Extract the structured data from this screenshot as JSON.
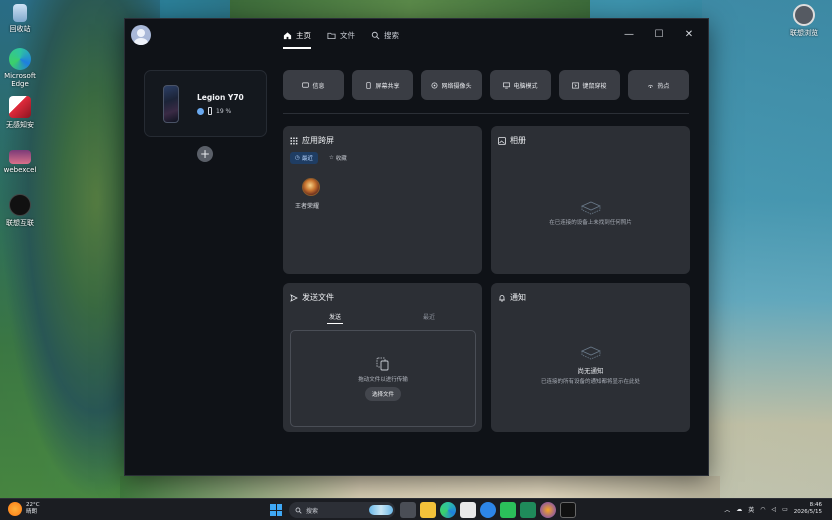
{
  "desktop": {
    "icons_left": [
      {
        "label": "回收站"
      },
      {
        "label": "Microsoft Edge"
      },
      {
        "label": "无感知安"
      },
      {
        "label": "webexcel"
      },
      {
        "label": "联想互联"
      }
    ],
    "icon_right": {
      "label": "联想浏览"
    }
  },
  "window": {
    "nav": [
      {
        "label": "主页",
        "icon": "home-icon"
      },
      {
        "label": "文件",
        "icon": "folder-icon"
      },
      {
        "label": "搜索",
        "icon": "search-icon"
      }
    ],
    "controls": {
      "minimize": "—",
      "maximize": "☐",
      "close": "✕"
    }
  },
  "device": {
    "name": "Legion Y70",
    "battery": "19 %"
  },
  "quick_actions": [
    {
      "label": "信息",
      "icon": "message-icon"
    },
    {
      "label": "屏幕共享",
      "icon": "screen-share-icon"
    },
    {
      "label": "网络摄像头",
      "icon": "webcam-icon"
    },
    {
      "label": "电脑模式",
      "icon": "monitor-icon"
    },
    {
      "label": "键鼠穿梭",
      "icon": "keyboard-mouse-icon"
    },
    {
      "label": "热点",
      "icon": "hotspot-icon"
    }
  ],
  "cards": {
    "apps": {
      "title": "应用跨屏",
      "tabs": [
        {
          "label": "最近"
        },
        {
          "label": "收藏"
        }
      ],
      "items": [
        {
          "label": "王者荣耀"
        }
      ]
    },
    "album": {
      "title": "相册",
      "empty_text": "在已连接的设备上未找到任何照片"
    },
    "send": {
      "title": "发送文件",
      "tabs": [
        {
          "label": "发送"
        },
        {
          "label": "最近"
        }
      ],
      "drop_text": "拖动文件以进行传输",
      "pick_button": "选择文件"
    },
    "notify": {
      "title": "通知",
      "empty_title": "尚无通知",
      "empty_text": "已连接的所有设备的通知都将显示在此处"
    }
  },
  "taskbar": {
    "weather_temp": "22°C",
    "weather_desc": "晴朗",
    "search_placeholder": "搜索",
    "ime": "英",
    "time": "8:46",
    "date": "2026/5/15"
  }
}
